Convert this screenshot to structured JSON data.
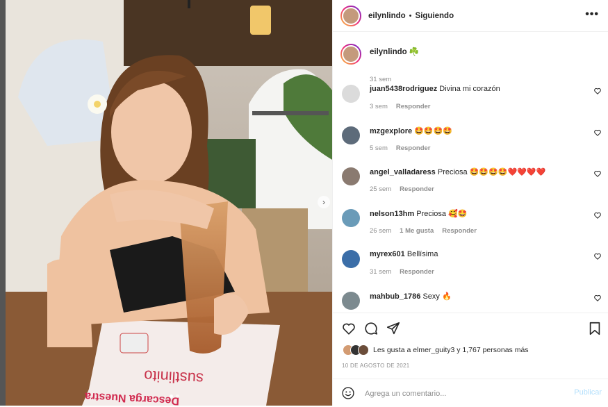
{
  "post": {
    "username": "eilynlindo",
    "separator": "•",
    "follow_status": "Siguiendo",
    "more_label": "•••",
    "caption": "eilynlindo",
    "caption_emoji": "☘️",
    "caption_time": "31 sem",
    "likes_text": "Les gusta a elmer_guity3 y 1,767 personas más",
    "date": "10 DE AGOSTO DE 2021",
    "comment_placeholder": "Agrega un comentario...",
    "publish_label": "Publicar",
    "next_arrow": "›",
    "carousel_total": 2,
    "carousel_active": 0
  },
  "comments": [
    {
      "user": "juan5438rodriguez",
      "text": "Divina mi corazón",
      "time": "3 sem",
      "likes": "",
      "reply": "Responder",
      "avatar_color": "#dbdbdb"
    },
    {
      "user": "mzgexplore",
      "text": "🤩🤩🤩🤩",
      "time": "5 sem",
      "likes": "",
      "reply": "Responder",
      "avatar_color": "#5d6b7a"
    },
    {
      "user": "angel_valladaress",
      "text": "Preciosa 🤩🤩🤩🤩❤️❤️❤️❤️",
      "time": "25 sem",
      "likes": "",
      "reply": "Responder",
      "avatar_color": "#8a7a70"
    },
    {
      "user": "nelson13hm",
      "text": "Preciosa 🥰🤩",
      "time": "26 sem",
      "likes": "1 Me gusta",
      "reply": "Responder",
      "avatar_color": "#6a9bb8"
    },
    {
      "user": "myrex601",
      "text": "Bellísima",
      "time": "31 sem",
      "likes": "",
      "reply": "Responder",
      "avatar_color": "#3b6ea8"
    },
    {
      "user": "mahbub_1786",
      "text": "Sexy 🔥",
      "time": "",
      "likes": "",
      "reply": "",
      "avatar_color": "#7c8a8f"
    }
  ]
}
